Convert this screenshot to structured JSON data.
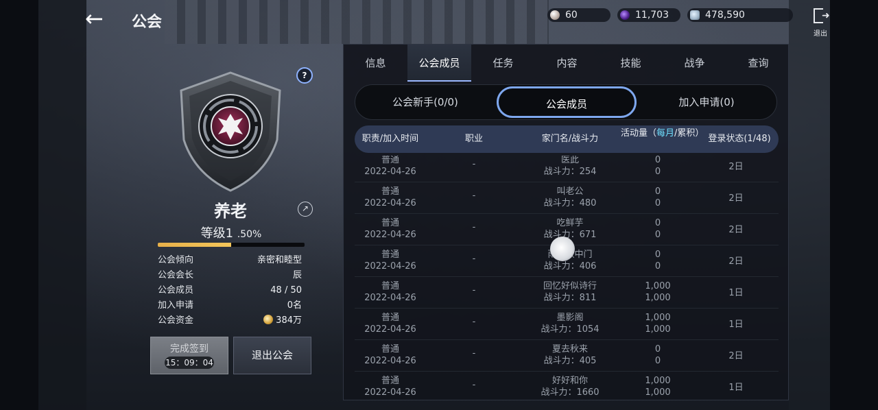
{
  "header": {
    "title": "公会",
    "currencies": [
      {
        "icon": "pearl-icon",
        "value": "60"
      },
      {
        "icon": "purple-orb-icon",
        "value": "11,703"
      },
      {
        "icon": "silver-coin-icon",
        "value": "478,590"
      }
    ],
    "exit_label": "退出"
  },
  "guild": {
    "name": "养老",
    "level": "等级1",
    "level_percent": ".50%",
    "exp_progress": 0.5,
    "info": [
      {
        "key": "公会倾向",
        "value": "亲密和睦型"
      },
      {
        "key": "公会会长",
        "value": "辰"
      },
      {
        "key": "公会成员",
        "value": "48 / 50"
      },
      {
        "key": "加入申请",
        "value": "0名"
      },
      {
        "key": "公会资金",
        "value": "384万"
      }
    ],
    "checkin_label": "完成签到",
    "checkin_timer": "15：09：04",
    "leave_label": "退出公会"
  },
  "tabs": [
    "信息",
    "公会成员",
    "任务",
    "内容",
    "技能",
    "战争",
    "查询"
  ],
  "active_tab": "公会成员",
  "subtabs": [
    "公会新手(0/0)",
    "公会成员",
    "加入申请(0)"
  ],
  "table": {
    "headers": {
      "role": "职责/加入时间",
      "job": "职业",
      "family": "家门名/战斗力",
      "activity_pre": "活动量（",
      "activity_hl": "每月",
      "activity_post": "/累积）",
      "login": "登录状态(1/48)"
    },
    "rows": [
      {
        "role": "普通",
        "date": "2022-04-26",
        "job": "-",
        "family": "医此",
        "power": "战斗力：254",
        "monthly": "0",
        "total": "0",
        "login": "2日"
      },
      {
        "role": "普通",
        "date": "2022-04-26",
        "job": "-",
        "family": "叫老公",
        "power": "战斗力：480",
        "monthly": "0",
        "total": "0",
        "login": "2日"
      },
      {
        "role": "普通",
        "date": "2022-04-26",
        "job": "-",
        "family": "吃鲜芋",
        "power": "战斗力：671",
        "monthly": "0",
        "total": "0",
        "login": "2日"
      },
      {
        "role": "普通",
        "date": "2022-04-26",
        "job": "-",
        "family": "雨天秋中门",
        "power": "战斗力：406",
        "monthly": "0",
        "total": "0",
        "login": "2日"
      },
      {
        "role": "普通",
        "date": "2022-04-26",
        "job": "-",
        "family": "回忆好似诗行",
        "power": "战斗力：811",
        "monthly": "1,000",
        "total": "1,000",
        "login": "1日"
      },
      {
        "role": "普通",
        "date": "2022-04-26",
        "job": "-",
        "family": "墨影阁",
        "power": "战斗力：1054",
        "monthly": "1,000",
        "total": "1,000",
        "login": "1日"
      },
      {
        "role": "普通",
        "date": "2022-04-26",
        "job": "-",
        "family": "夏去秋来",
        "power": "战斗力：405",
        "monthly": "0",
        "total": "0",
        "login": "2日"
      },
      {
        "role": "普通",
        "date": "2022-04-26",
        "job": "-",
        "family": "好好和你",
        "power": "战斗力：1660",
        "monthly": "1,000",
        "total": "1,000",
        "login": "1日"
      }
    ]
  }
}
